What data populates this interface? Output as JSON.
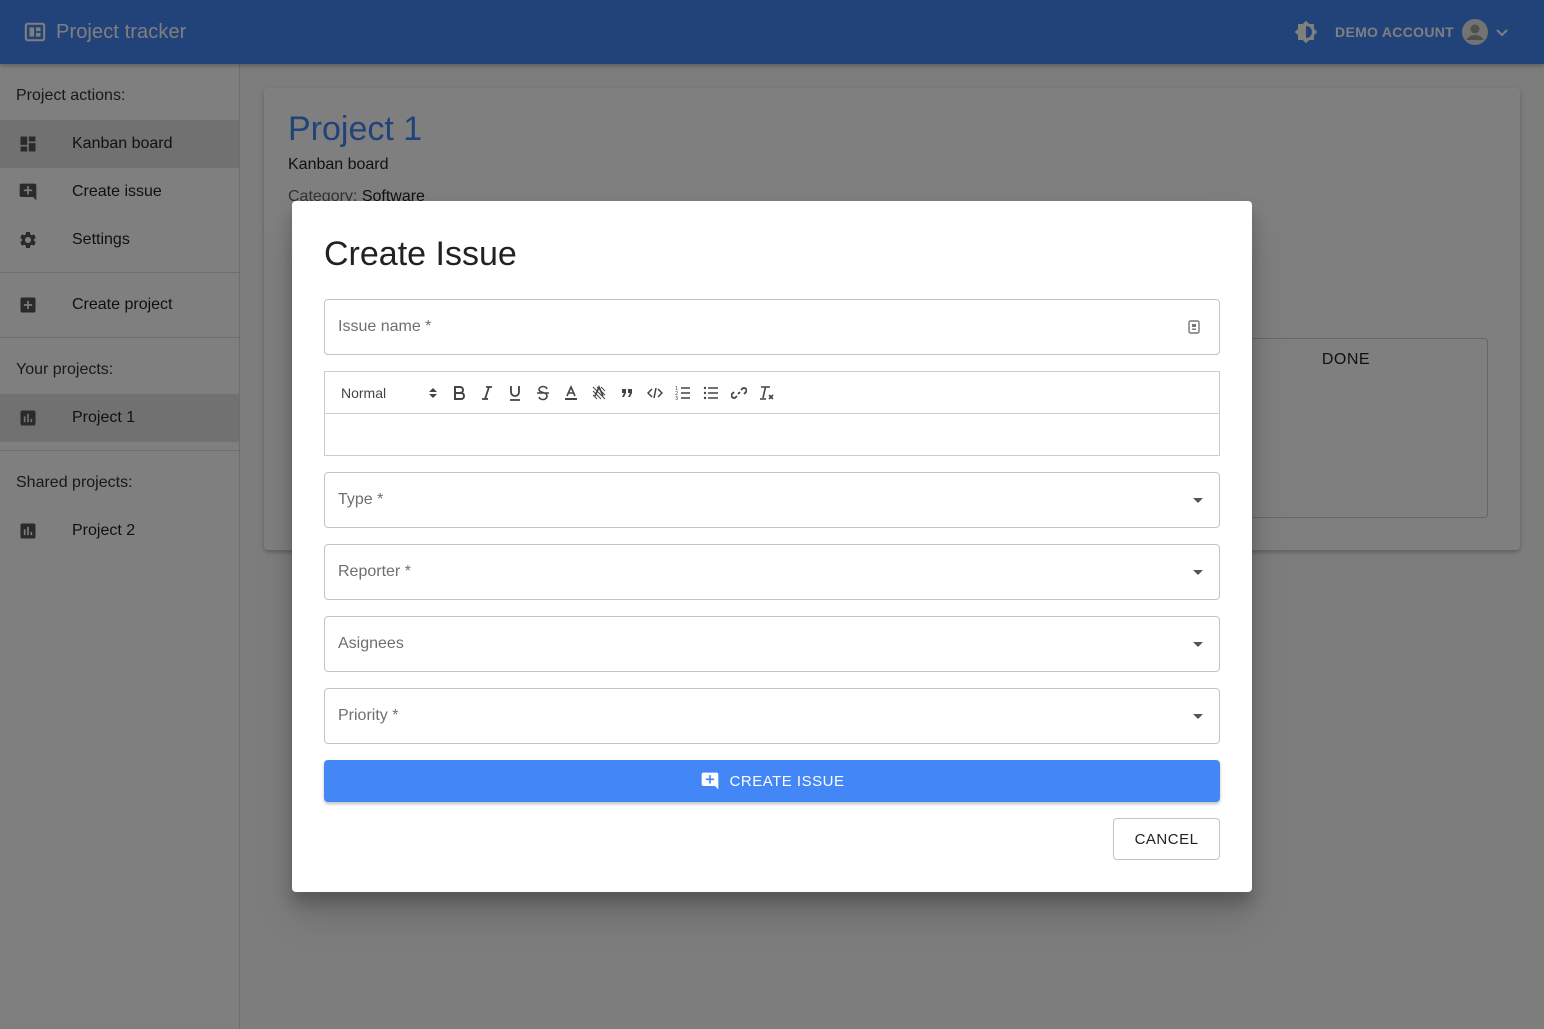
{
  "colors": {
    "primary": "#4287f5",
    "overlay": "rgba(0,0,0,0.5)"
  },
  "appbar": {
    "title": "Project tracker",
    "logo_icon": "dashboard-icon",
    "theme_icon": "brightness-icon",
    "account_label": "DEMO ACCOUNT",
    "avatar_icon": "account-circle-icon",
    "chevron_icon": "chevron-down-icon"
  },
  "sidebar": {
    "project_actions_heading": "Project actions:",
    "actions": [
      {
        "label": "Kanban board",
        "icon": "dashboard-icon",
        "active": true
      },
      {
        "label": "Create issue",
        "icon": "add-comment-icon",
        "active": false
      },
      {
        "label": "Settings",
        "icon": "gear-icon",
        "active": false
      }
    ],
    "create_project": {
      "label": "Create project",
      "icon": "add-box-icon"
    },
    "your_projects_heading": "Your projects:",
    "your_projects": [
      {
        "label": "Project 1",
        "icon": "chart-icon",
        "active": true
      }
    ],
    "shared_projects_heading": "Shared projects:",
    "shared_projects": [
      {
        "label": "Project 2",
        "icon": "chart-icon",
        "active": false
      }
    ]
  },
  "main": {
    "project_title": "Project 1",
    "subtitle": "Kanban board",
    "category_label": "Category: ",
    "category_value": "Software",
    "done_column_label": "DONE"
  },
  "dialog": {
    "title": "Create Issue",
    "issue_name_placeholder": "Issue name *",
    "issue_name_icon": "password-manager-icon",
    "editor": {
      "format_value": "Normal",
      "tools": [
        "bold-icon",
        "italic-icon",
        "underline-icon",
        "strike-icon",
        "text-color-icon",
        "background-color-icon",
        "blockquote-icon",
        "code-icon",
        "ordered-list-icon",
        "bullet-list-icon",
        "link-icon",
        "clear-format-icon"
      ]
    },
    "type_placeholder": "Type *",
    "reporter_placeholder": "Reporter *",
    "assignees_placeholder": "Asignees",
    "priority_placeholder": "Priority *",
    "create_button_label": "CREATE ISSUE",
    "create_button_icon": "add-comment-icon",
    "cancel_button_label": "CANCEL"
  }
}
